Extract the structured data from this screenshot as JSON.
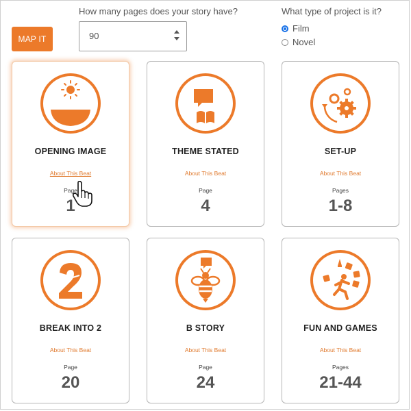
{
  "controls": {
    "map_button": "MAP IT",
    "pages_question": "How many pages does your story have?",
    "pages_value": "90",
    "type_question": "What type of project is it?",
    "options": [
      {
        "label": "Film",
        "selected": true
      },
      {
        "label": "Novel",
        "selected": false
      }
    ]
  },
  "cards": [
    {
      "title": "OPENING IMAGE",
      "about": "About This Beat",
      "pages_label": "Page",
      "pages": "1",
      "icon": "sunrise-icon"
    },
    {
      "title": "THEME STATED",
      "about": "About This Beat",
      "pages_label": "Page",
      "pages": "4",
      "icon": "speech-book-icon"
    },
    {
      "title": "SET-UP",
      "about": "About This Beat",
      "pages_label": "Pages",
      "pages": "1-8",
      "icon": "gears-icon"
    },
    {
      "title": "BREAK INTO 2",
      "about": "About This Beat",
      "pages_label": "Page",
      "pages": "20",
      "icon": "number-two-icon"
    },
    {
      "title": "B STORY",
      "about": "About This Beat",
      "pages_label": "Page",
      "pages": "24",
      "icon": "bee-icon"
    },
    {
      "title": "FUN AND GAMES",
      "about": "About This Beat",
      "pages_label": "Pages",
      "pages": "21-44",
      "icon": "running-person-icon"
    }
  ],
  "colors": {
    "accent": "#ec7a2a",
    "radio": "#1a73e8"
  }
}
